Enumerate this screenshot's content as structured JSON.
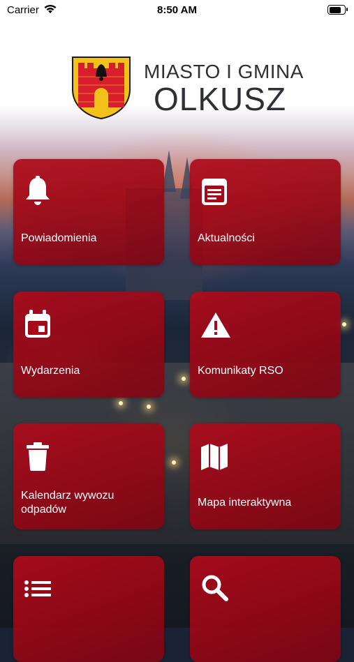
{
  "status_bar": {
    "carrier": "Carrier",
    "time": "8:50 AM"
  },
  "header": {
    "line1": "MIASTO I GMINA",
    "line2": "OLKUSZ"
  },
  "tiles": [
    {
      "label": "Powiadomienia",
      "icon": "bell-icon"
    },
    {
      "label": "Aktualności",
      "icon": "news-icon"
    },
    {
      "label": "Wydarzenia",
      "icon": "calendar-icon"
    },
    {
      "label": "Komunikaty RSO",
      "icon": "warning-icon"
    },
    {
      "label": "Kalendarz wywozu odpadów",
      "icon": "trash-icon"
    },
    {
      "label": "Mapa interaktywna",
      "icon": "map-icon"
    },
    {
      "label": "",
      "icon": "list-icon"
    },
    {
      "label": "",
      "icon": "search-icon"
    }
  ],
  "colors": {
    "tile": "#a8091a",
    "crest_yellow": "#f2c21b",
    "crest_red": "#d81e2c",
    "title": "#2f2f36"
  }
}
